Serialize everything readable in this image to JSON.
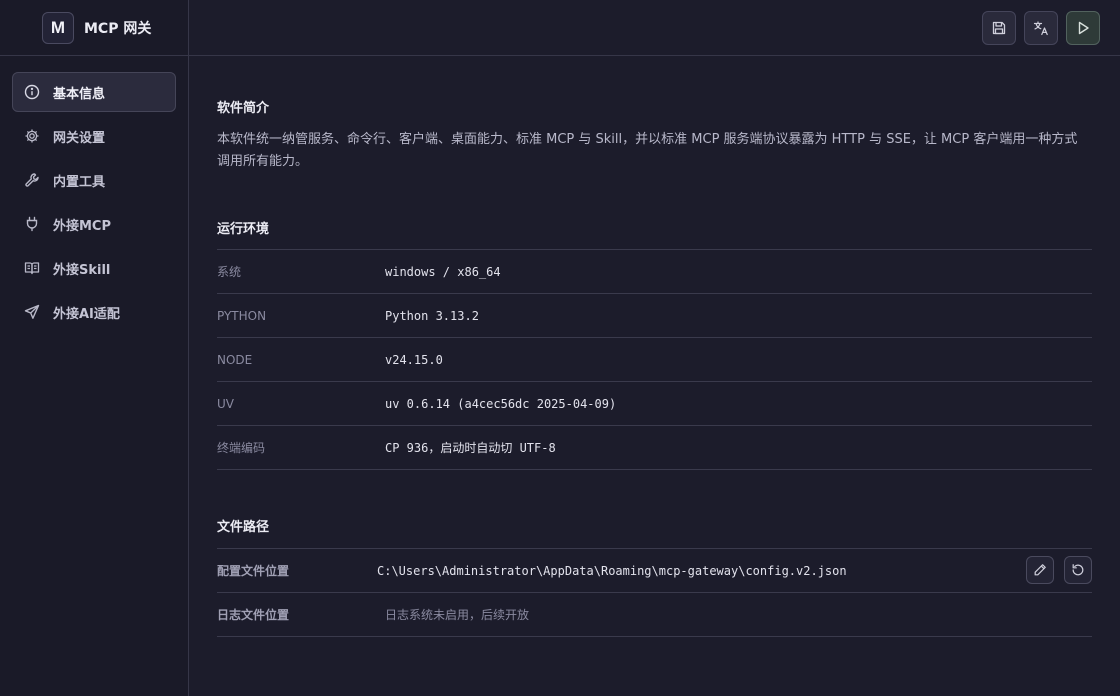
{
  "app": {
    "logo_letter": "M",
    "title": "MCP 网关"
  },
  "sidebar": {
    "items": [
      {
        "label": "基本信息",
        "icon": "info-icon",
        "active": true
      },
      {
        "label": "网关设置",
        "icon": "gear-icon",
        "active": false
      },
      {
        "label": "内置工具",
        "icon": "wrench-icon",
        "active": false
      },
      {
        "label": "外接MCP",
        "icon": "plug-icon",
        "active": false
      },
      {
        "label": "外接Skill",
        "icon": "book-icon",
        "active": false
      },
      {
        "label": "外接AI适配",
        "icon": "send-icon",
        "active": false
      }
    ]
  },
  "header": {
    "buttons": [
      {
        "icon": "save-icon"
      },
      {
        "icon": "translate-icon"
      },
      {
        "icon": "play-icon"
      }
    ]
  },
  "intro": {
    "title": "软件简介",
    "text": "本软件统一纳管服务、命令行、客户端、桌面能力、标准 MCP 与 Skill，并以标准 MCP 服务端协议暴露为 HTTP 与 SSE，让 MCP 客户端用一种方式调用所有能力。"
  },
  "env": {
    "title": "运行环境",
    "rows": [
      {
        "key": "系统",
        "value": "windows / x86_64"
      },
      {
        "key": "PYTHON",
        "value": "Python 3.13.2"
      },
      {
        "key": "NODE",
        "value": "v24.15.0"
      },
      {
        "key": "UV",
        "value": "uv 0.6.14 (a4cec56dc 2025-04-09)"
      },
      {
        "key": "终端编码",
        "value": "CP 936，启动时自动切 UTF-8"
      }
    ]
  },
  "paths": {
    "title": "文件路径",
    "config_label": "配置文件位置",
    "config_value": "C:\\Users\\Administrator\\AppData\\Roaming\\mcp-gateway\\config.v2.json",
    "log_label": "日志文件位置",
    "log_value": "日志系统未启用，后续开放"
  },
  "colors": {
    "background": "#1c1c2b",
    "sidebar": "#1a1a28",
    "border": "#363648",
    "active_item": "#2b2b3d",
    "run_button": "#2e3a38"
  }
}
